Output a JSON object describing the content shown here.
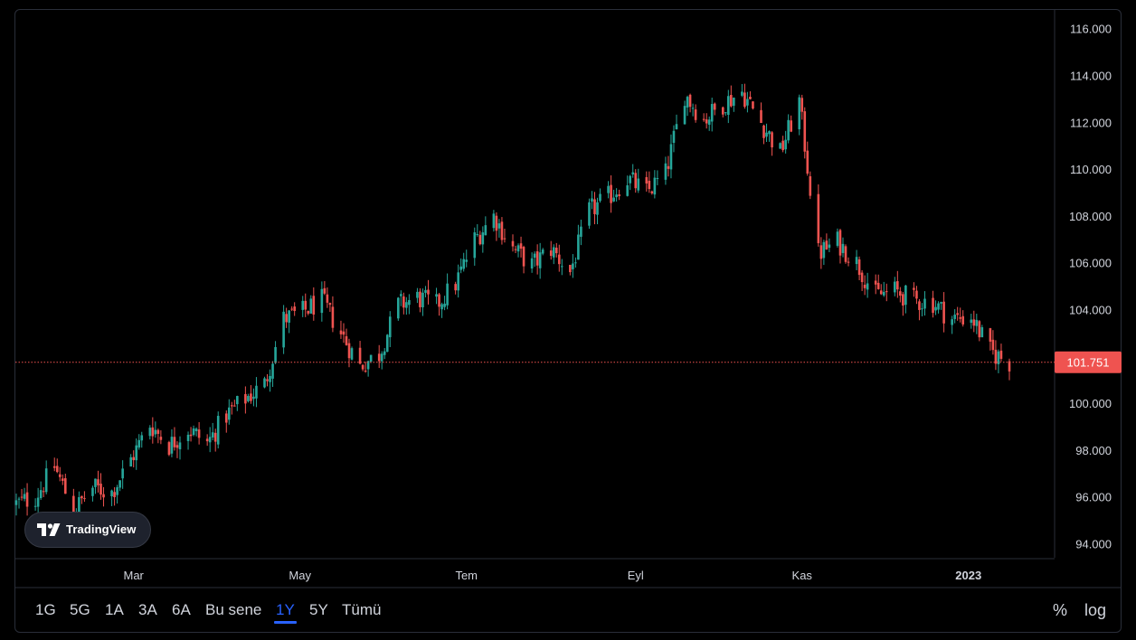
{
  "chart_data": {
    "type": "candlestick",
    "y_ticks": [
      "116.000",
      "114.000",
      "112.000",
      "110.000",
      "108.000",
      "106.000",
      "104.000",
      "102.000",
      "100.000",
      "98.000",
      "96.000",
      "94.000"
    ],
    "x_ticks": [
      {
        "label": "Mar",
        "bold": false
      },
      {
        "label": "May",
        "bold": false
      },
      {
        "label": "Tem",
        "bold": false
      },
      {
        "label": "Eyl",
        "bold": false
      },
      {
        "label": "Kas",
        "bold": false
      },
      {
        "label": "2023",
        "bold": true
      }
    ],
    "ylim": [
      93.4,
      116.8
    ],
    "current_price": "101.751",
    "current_price_value": 101.751,
    "up_color": "#26a69a",
    "down_color": "#ef5350",
    "close_path": [
      [
        "2022-01-17",
        95.7
      ],
      [
        "2022-01-24",
        96.0
      ],
      [
        "2022-01-31",
        97.3
      ],
      [
        "2022-02-07",
        95.4
      ],
      [
        "2022-02-14",
        96.4
      ],
      [
        "2022-02-21",
        96.2
      ],
      [
        "2022-02-28",
        97.6
      ],
      [
        "2022-03-07",
        99.1
      ],
      [
        "2022-03-14",
        98.2
      ],
      [
        "2022-03-21",
        98.9
      ],
      [
        "2022-03-28",
        98.3
      ],
      [
        "2022-04-04",
        99.5
      ],
      [
        "2022-04-11",
        100.2
      ],
      [
        "2022-04-18",
        100.8
      ],
      [
        "2022-04-25",
        103.6
      ],
      [
        "2022-05-02",
        103.9
      ],
      [
        "2022-05-09",
        104.4
      ],
      [
        "2022-05-16",
        103.0
      ],
      [
        "2022-05-23",
        101.6
      ],
      [
        "2022-05-30",
        102.1
      ],
      [
        "2022-06-06",
        104.2
      ],
      [
        "2022-06-13",
        104.5
      ],
      [
        "2022-06-20",
        104.2
      ],
      [
        "2022-06-27",
        105.1
      ],
      [
        "2022-07-04",
        107.0
      ],
      [
        "2022-07-11",
        108.0
      ],
      [
        "2022-07-18",
        106.6
      ],
      [
        "2022-07-25",
        105.9
      ],
      [
        "2022-08-01",
        106.6
      ],
      [
        "2022-08-08",
        105.6
      ],
      [
        "2022-08-15",
        108.2
      ],
      [
        "2022-08-22",
        108.8
      ],
      [
        "2022-08-29",
        109.6
      ],
      [
        "2022-09-05",
        109.0
      ],
      [
        "2022-09-12",
        109.8
      ],
      [
        "2022-09-19",
        113.2
      ],
      [
        "2022-09-26",
        112.1
      ],
      [
        "2022-10-03",
        112.8
      ],
      [
        "2022-10-10",
        113.3
      ],
      [
        "2022-10-17",
        112.0
      ],
      [
        "2022-10-24",
        110.7
      ],
      [
        "2022-10-31",
        112.9
      ],
      [
        "2022-11-07",
        106.4
      ],
      [
        "2022-11-14",
        106.9
      ],
      [
        "2022-11-21",
        106.0
      ],
      [
        "2022-11-28",
        104.6
      ],
      [
        "2022-12-05",
        104.8
      ],
      [
        "2022-12-12",
        104.4
      ],
      [
        "2022-12-19",
        104.3
      ],
      [
        "2022-12-26",
        103.6
      ],
      [
        "2023-01-02",
        103.7
      ],
      [
        "2023-01-09",
        102.2
      ],
      [
        "2023-01-16",
        101.75
      ]
    ]
  },
  "branding": {
    "logo_icon": "tradingview-logo-icon",
    "text": "TradingView"
  },
  "toolbar": {
    "ranges": [
      {
        "label": "1G",
        "active": false
      },
      {
        "label": "5G",
        "active": false
      },
      {
        "label": "1A",
        "active": false
      },
      {
        "label": "3A",
        "active": false
      },
      {
        "label": "6A",
        "active": false
      },
      {
        "label": "Bu sene",
        "active": false
      },
      {
        "label": "1Y",
        "active": true
      },
      {
        "label": "5Y",
        "active": false
      },
      {
        "label": "Tümü",
        "active": false
      }
    ],
    "percent_label": "%",
    "log_label": "log"
  }
}
